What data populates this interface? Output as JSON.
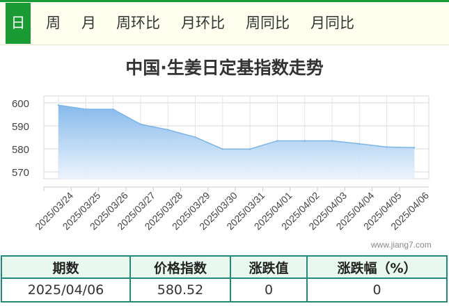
{
  "tabs": [
    {
      "label": "日",
      "active": true
    },
    {
      "label": "周",
      "active": false
    },
    {
      "label": "月",
      "active": false
    },
    {
      "label": "周环比",
      "active": false
    },
    {
      "label": "月环比",
      "active": false
    },
    {
      "label": "周同比",
      "active": false
    },
    {
      "label": "月同比",
      "active": false
    }
  ],
  "colors": {
    "accent": "#1a9a32",
    "area_top": "#7fb6ea",
    "line": "#7cb4e8",
    "table_border": "#1f8a7a"
  },
  "chart_data": {
    "type": "area",
    "title": "中国·生姜日定基指数走势",
    "categories": [
      "2025/03/24",
      "2025/03/25",
      "2025/03/26",
      "2025/03/27",
      "2025/03/28",
      "2025/03/29",
      "2025/03/30",
      "2025/03/31",
      "2025/04/01",
      "2025/04/02",
      "2025/04/03",
      "2025/04/04",
      "2025/04/05",
      "2025/04/06"
    ],
    "values": [
      599.0,
      597.2,
      597.2,
      590.7,
      588.3,
      585.1,
      579.9,
      579.9,
      583.5,
      583.5,
      583.5,
      582.2,
      580.8,
      580.52
    ],
    "yticks": [
      570,
      580,
      590,
      600
    ],
    "ylim": [
      567,
      603
    ],
    "grid": true
  },
  "watermark": "www.jiang7.com",
  "table": {
    "headers": [
      "期数",
      "价格指数",
      "涨跌值",
      "涨跌幅（%）"
    ],
    "rows": [
      [
        "2025/04/06",
        "580.52",
        "0",
        "0"
      ]
    ]
  }
}
